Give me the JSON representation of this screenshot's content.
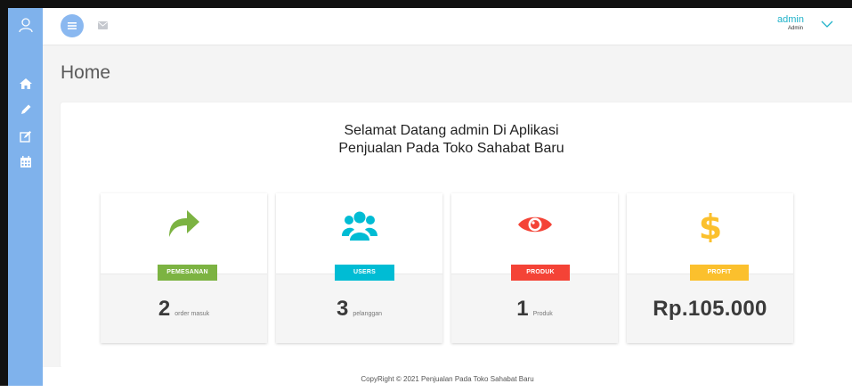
{
  "header": {
    "user_name": "admin",
    "user_role": "Admin"
  },
  "page": {
    "title": "Home",
    "welcome_line1": "Selamat Datang admin Di Aplikasi",
    "welcome_line2": "Penjualan Pada Toko Sahabat Baru"
  },
  "cards": [
    {
      "label": "PEMESANAN",
      "value": "2",
      "unit": "order masuk",
      "icon": "share-arrow-icon",
      "color": "#7cb342"
    },
    {
      "label": "USERS",
      "value": "3",
      "unit": "pelanggan",
      "icon": "users-icon",
      "color": "#00bcd4"
    },
    {
      "label": "PRODUK",
      "value": "1",
      "unit": "Produk",
      "icon": "eye-icon",
      "color": "#f44336"
    },
    {
      "label": "PROFIT",
      "value": "Rp.105.000",
      "icon": "dollar-icon",
      "color": "#fbc02d"
    }
  ],
  "footer": {
    "text": "CopyRight © 2021 Penjualan Pada Toko Sahabat Baru"
  },
  "colors": {
    "sidebar": "#7fb2ec",
    "accent": "#1fb2c9"
  }
}
